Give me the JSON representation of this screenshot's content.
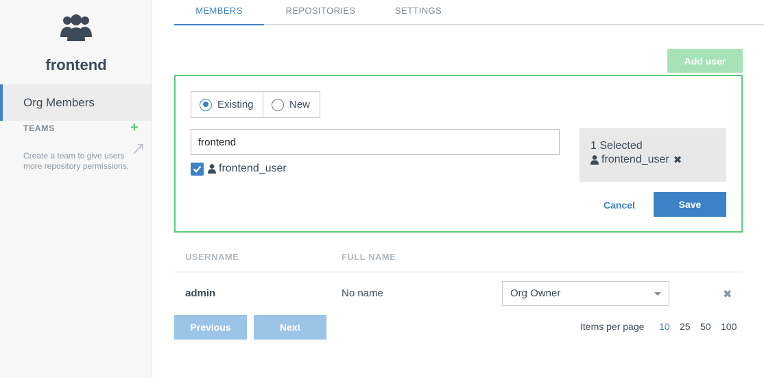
{
  "sidebar": {
    "team_icon": "users-icon",
    "team_name": "frontend",
    "nav_org_members": "Org Members",
    "teams_heading": "TEAMS",
    "add_team_icon": "plus-icon",
    "teams_help": "Create a team to give users more repository permissions."
  },
  "tabs": [
    {
      "label": "MEMBERS",
      "active": true
    },
    {
      "label": "REPOSITORIES",
      "active": false
    },
    {
      "label": "SETTINGS",
      "active": false
    }
  ],
  "add_user_label": "Add user",
  "add_panel": {
    "radio_existing": "Existing",
    "radio_new": "New",
    "selected_radio": "Existing",
    "search_value": "frontend",
    "result_user": "frontend_user",
    "result_checked": true,
    "selected_count": "1 Selected",
    "selected_user": "frontend_user",
    "cancel_label": "Cancel",
    "save_label": "Save"
  },
  "table": {
    "headers": [
      "USERNAME",
      "FULL NAME"
    ],
    "rows": [
      {
        "username": "admin",
        "full_name": "No name",
        "role": "Org Owner"
      }
    ]
  },
  "pagination": {
    "previous_label": "Previous",
    "next_label": "Next",
    "items_per_page_label": "Items per page",
    "options": [
      "10",
      "25",
      "50",
      "100"
    ],
    "selected": "10"
  },
  "colors": {
    "accent": "#3d82c4",
    "success": "#5ccc7a"
  }
}
